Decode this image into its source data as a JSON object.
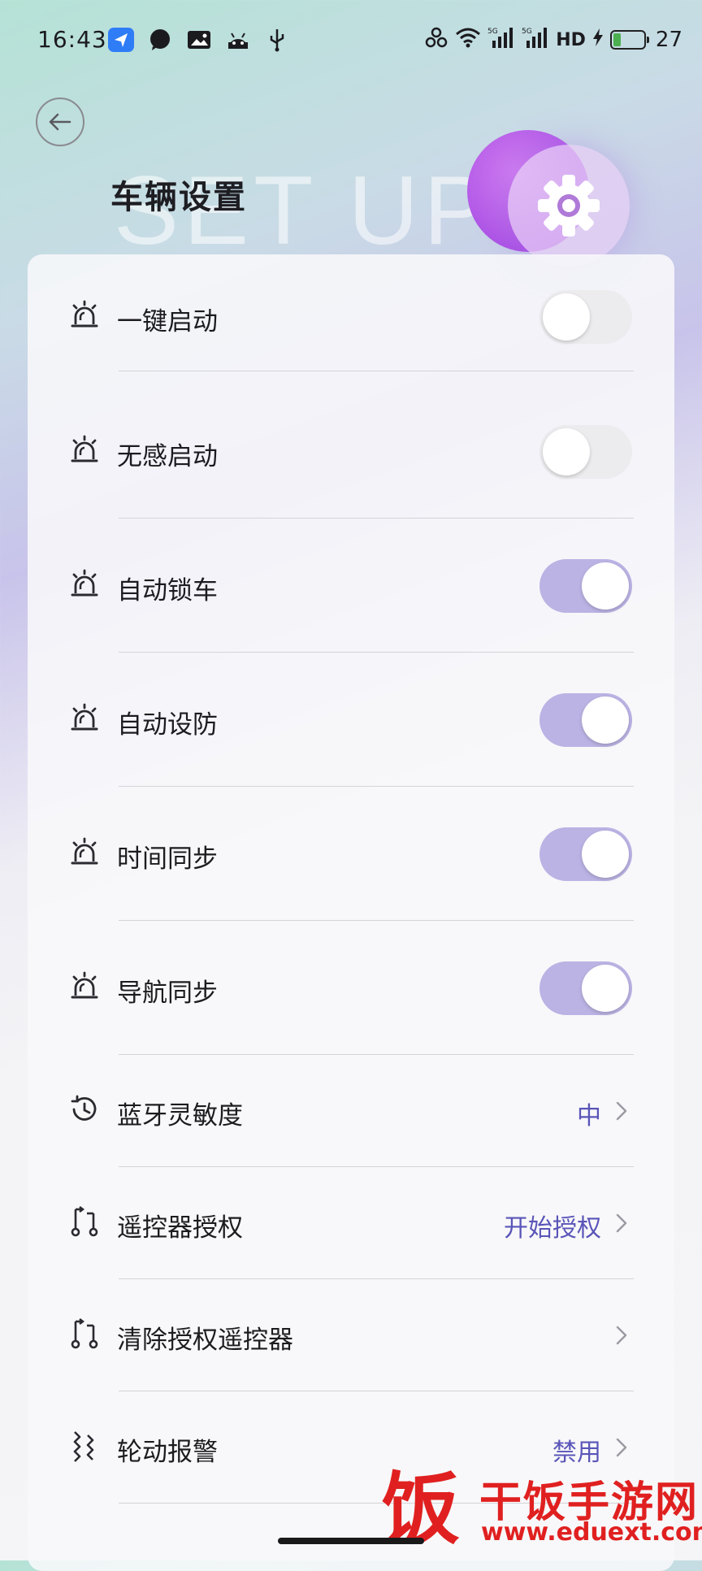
{
  "status_bar": {
    "time": "16:43",
    "network_label": "HD",
    "battery": "27",
    "battery_level": 0.27
  },
  "header": {
    "title": "车辆设置",
    "background_text": "SET UP",
    "back_icon": "arrow-left-icon",
    "badge_icon": "gear-icon"
  },
  "settings": [
    {
      "label": "一键启动",
      "icon": "siren-icon",
      "type": "toggle",
      "state": "off"
    },
    {
      "label": "无感启动",
      "icon": "siren-icon",
      "type": "toggle",
      "state": "off"
    },
    {
      "label": "自动锁车",
      "icon": "siren-icon",
      "type": "toggle",
      "state": "on"
    },
    {
      "label": "自动设防",
      "icon": "siren-icon",
      "type": "toggle",
      "state": "on"
    },
    {
      "label": "时间同步",
      "icon": "siren-icon",
      "type": "toggle",
      "state": "on"
    },
    {
      "label": "导航同步",
      "icon": "siren-icon",
      "type": "toggle",
      "state": "on"
    },
    {
      "label": "蓝牙灵敏度",
      "icon": "history-icon",
      "type": "link",
      "value": "中"
    },
    {
      "label": "遥控器授权",
      "icon": "transfer-icon",
      "type": "link",
      "value": "开始授权"
    },
    {
      "label": "清除授权遥控器",
      "icon": "transfer-icon",
      "type": "link",
      "value": ""
    },
    {
      "label": "轮动报警",
      "icon": "vibration-icon",
      "type": "link",
      "value": "禁用"
    }
  ],
  "watermark": {
    "logo_char": "饭",
    "name": "干饭手游网",
    "url": "www.eduext.com"
  },
  "colors": {
    "accent": "#5a55b8",
    "toggle_on": "#bbb3e4",
    "toggle_off": "#ececef",
    "watermark": "#e02020"
  }
}
